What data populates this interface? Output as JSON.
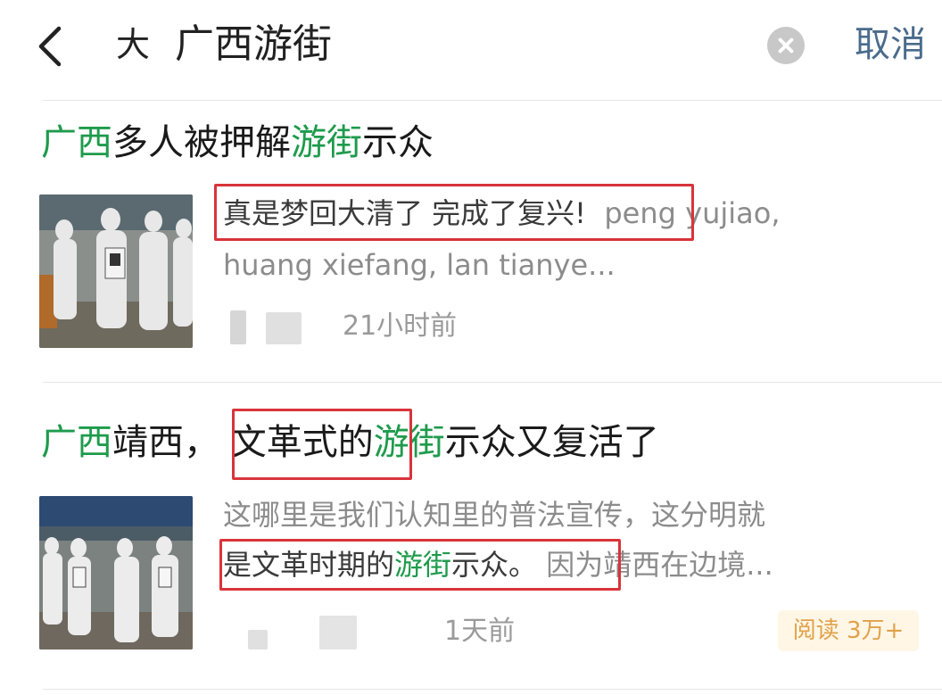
{
  "header": {
    "back_icon": "chevron-left-icon",
    "search_logo": "大",
    "query": "广西游街",
    "clear_icon": "clear-circle-icon",
    "cancel_label": "取消"
  },
  "results": [
    {
      "title_parts": [
        "广西",
        "多人被押解",
        "游街",
        "示众"
      ],
      "snippet_line1_a": "真是梦回大清了 完成了复兴!",
      "snippet_line1_b": "peng yujiao,",
      "snippet_line2": "huang xiefang, lan tianye...",
      "time": "21小时前"
    },
    {
      "title_parts": [
        "广西",
        "靖西，",
        "文革式的",
        "游街",
        "示众又复活了"
      ],
      "snippet_line1": "这哪里是我们认知里的普法宣传，这分明就",
      "snippet_line2_a": "是文革时期的",
      "snippet_line2_hl": "游街",
      "snippet_line2_b": "示众。",
      "snippet_line2_c": "因为靖西在边境...",
      "time": "1天前",
      "read_badge": "阅读 3万+"
    }
  ],
  "colors": {
    "highlight": "#1e9b4c",
    "cancel": "#4a6b8c",
    "annotation_box": "#d8343a",
    "badge_text": "#e0a24a"
  }
}
